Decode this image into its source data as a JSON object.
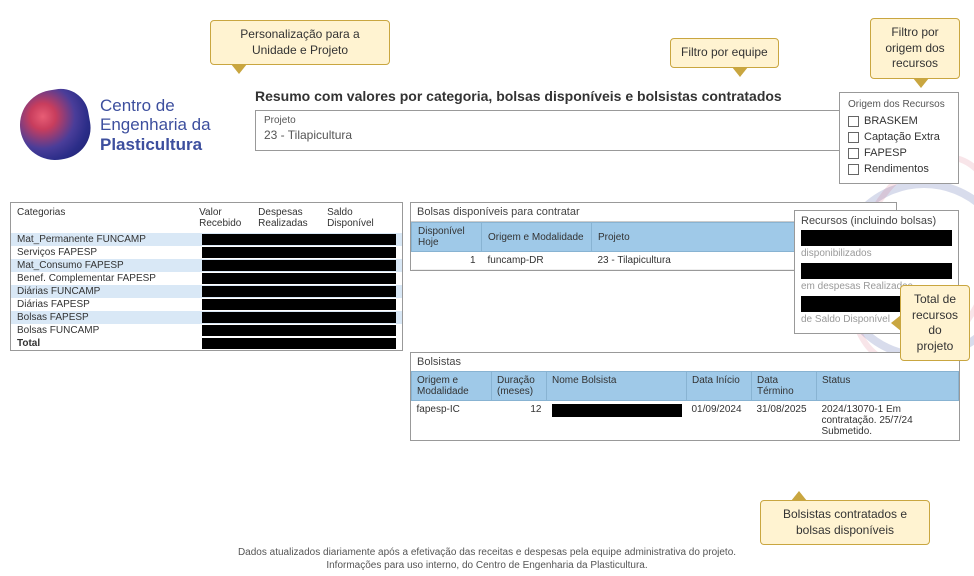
{
  "callouts": {
    "personalizacao": "Personalização para a Unidade e Projeto",
    "filtro_equipe": "Filtro por equipe",
    "filtro_origem": "Filtro por origem dos recursos",
    "total_recursos": "Total de recursos do projeto",
    "bolsistas": "Bolsistas contratados e bolsas disponíveis"
  },
  "logo": {
    "line1": "Centro de",
    "line2": "Engenharia da",
    "line3": "Plasticultura"
  },
  "title": "Resumo com valores por categoria, bolsas disponíveis e bolsistas contratados",
  "project": {
    "label": "Projeto",
    "value": "23 - Tilapicultura"
  },
  "origem": {
    "label": "Origem dos Recursos",
    "options": [
      "BRASKEM",
      "Captação Extra",
      "FAPESP",
      "Rendimentos"
    ]
  },
  "categorias": {
    "headers": {
      "c1": "Categorias",
      "c2": "Valor Recebido",
      "c3": "Despesas Realizadas",
      "c4": "Saldo Disponível"
    },
    "rows": [
      "Mat_Permanente FUNCAMP",
      "Serviços FAPESP",
      "Mat_Consumo FAPESP",
      "Benef. Complementar FAPESP",
      "Diárias FUNCAMP",
      "Diárias FAPESP",
      "Bolsas FAPESP",
      "Bolsas FUNCAMP"
    ],
    "total": "Total"
  },
  "bolsas_disp": {
    "title": "Bolsas disponíveis para contratar",
    "headers": {
      "c1": "Disponível Hoje",
      "c2": "Origem e Modalidade",
      "c3": "Projeto"
    },
    "rows": [
      {
        "disp": "1",
        "origem": "funcamp-DR",
        "projeto": "23 - Tilapicultura"
      }
    ]
  },
  "recursos": {
    "title": "Recursos (incluindo bolsas)",
    "sub1": "disponibilizados",
    "sub2": "em despesas Realizadas",
    "sub3": "de Saldo Disponível"
  },
  "bolsistas": {
    "title": "Bolsistas",
    "headers": {
      "c1": "Origem e Modalidade",
      "c2": "Duração (meses)",
      "c3": "Nome Bolsista",
      "c4": "Data Início",
      "c5": "Data Término",
      "c6": "Status"
    },
    "rows": [
      {
        "origem": "fapesp-IC",
        "duracao": "12",
        "nome": "",
        "inicio": "01/09/2024",
        "termino": "31/08/2025",
        "status": "2024/13070-1 Em contratação. 25/7/24 Submetido."
      }
    ]
  },
  "footer": {
    "l1": "Dados atualizados diariamente após a efetivação das receitas e despesas pela equipe administrativa do projeto.",
    "l2": "Informações para uso interno, do Centro de Engenharia da Plasticultura."
  }
}
